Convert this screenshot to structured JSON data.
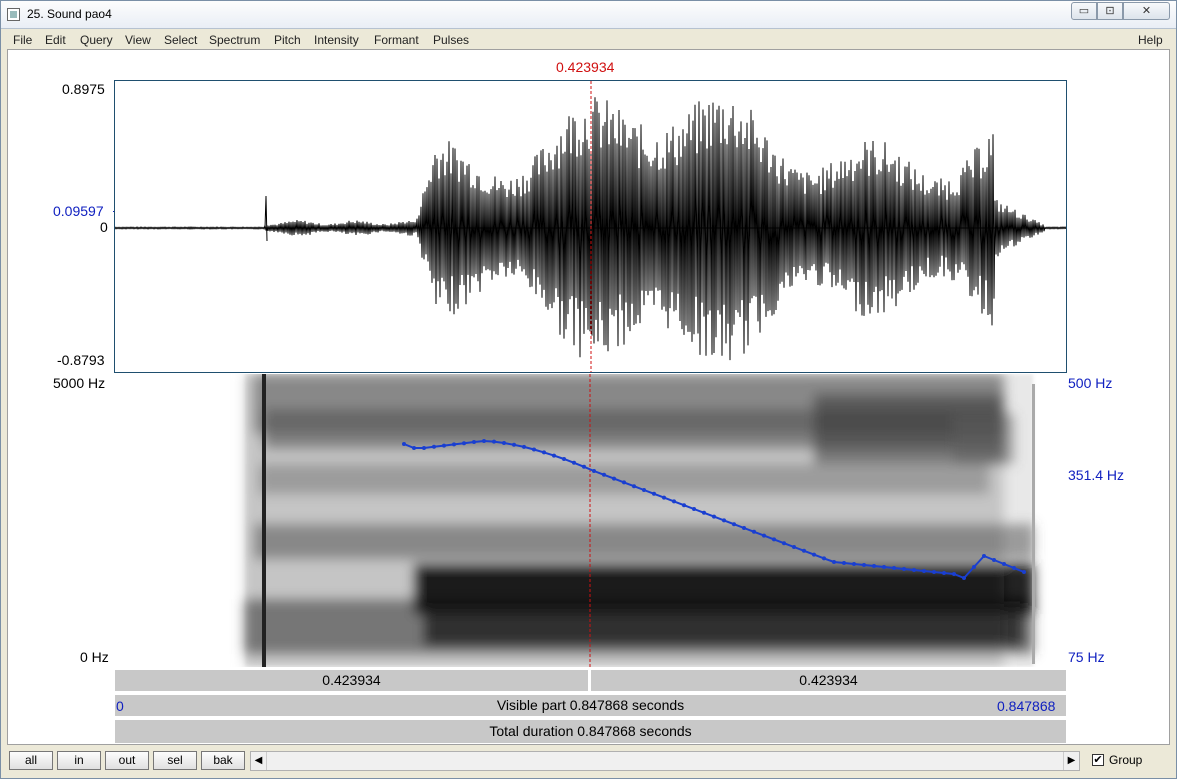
{
  "window": {
    "title": "25. Sound pao4"
  },
  "titlebar_buttons": {
    "minimize": "▭",
    "maximize": "⊡",
    "close": "✕"
  },
  "menu": {
    "items": [
      "File",
      "Edit",
      "Query",
      "View",
      "Select",
      "Spectrum",
      "Pitch",
      "Intensity",
      "Formant",
      "Pulses"
    ],
    "help": "Help"
  },
  "cursor": {
    "time_label": "0.423934"
  },
  "waveform": {
    "max_label": "0.8975",
    "cursor_value_label": "0.09597",
    "zero_label": "0",
    "min_label": "-0.8793"
  },
  "spectrogram": {
    "top_label": "5000 Hz",
    "bottom_label": "0 Hz"
  },
  "pitch": {
    "top_label": "500 Hz",
    "cursor_label": "351.4 Hz",
    "bottom_label": "75 Hz",
    "color": "#1a3fd0"
  },
  "time_bars": {
    "left_segment": "0.423934",
    "right_segment": "0.423934",
    "visible_start": "0",
    "visible_part": "Visible part 0.847868 seconds",
    "visible_end": "0.847868",
    "total_duration": "Total duration 0.847868 seconds"
  },
  "bottom_buttons": [
    "all",
    "in",
    "out",
    "sel",
    "bak"
  ],
  "scrollbar": {
    "left_arrow": "◀",
    "right_arrow": "▶"
  },
  "group": {
    "label": "Group",
    "checked": true,
    "check_mark": "✔"
  }
}
